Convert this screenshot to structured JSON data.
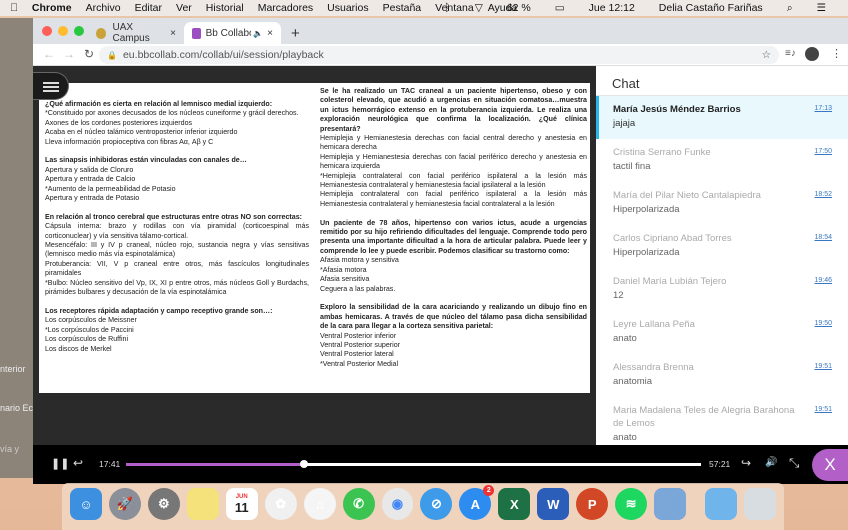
{
  "menubar": {
    "apple": "",
    "app": "Chrome",
    "items": [
      "Archivo",
      "Editar",
      "Ver",
      "Historial",
      "Marcadores",
      "Usuarios",
      "Pestaña",
      "Ventana",
      "Ayuda"
    ],
    "battery": "62 %",
    "clock": "Jue 12:12",
    "user": "Delia Castaño Fariñas"
  },
  "background_window": {
    "fragments": [
      "nterior",
      "nario Ec",
      "vía y"
    ]
  },
  "browser": {
    "tabs": [
      {
        "title": "UAX Campus"
      },
      {
        "title": "Bb Collaborate: TUTORIAS"
      }
    ],
    "url": "eu.bbcollab.com/collab/ui/session/playback"
  },
  "slide": {
    "left": [
      {
        "q": "¿Qué afirmación es cierta en relación al lemnisco medial izquierdo:",
        "a": [
          "*Constituido por axones decusados de los núcleos cuneiforme y grácil derechos.",
          "Axones de los cordones posteriores izquierdos",
          "Acaba en el núcleo talámico ventroposterior inferior izquierdo",
          "Lleva información propioceptiva con fibras Aα, Aβ y C"
        ]
      },
      {
        "q": "Las sinapsis inhibidoras están vinculadas con canales de…",
        "a": [
          "Apertura y salida de Cloruro",
          "Apertura y entrada de Calcio",
          "*Aumento de la permeabilidad de Potasio",
          "Apertura y entrada de Potasio"
        ]
      },
      {
        "q": "En relación al tronco cerebral que estructuras entre otras NO son correctas:",
        "a": [
          "Cápsula interna: brazo y rodillas con vía piramidal (corticoespinal más corticonuclear) y vía sensitiva tálamo-cortical.",
          "Mesencéfalo: III y IV p craneal, núcleo rojo, sustancia negra y vías sensitivas (lemnisco medio más vía espinotalámica)",
          "Protuberancia: VII, V p craneal entre otros, más fascículos longitudinales piramidales",
          "*Bulbo: Núcleo sensitivo del Vp, IX, XI p entre otros, más núcleos Goll y Burdachs, pirámides bulbares y decusación de la vía espinotalámica"
        ]
      },
      {
        "q": "Los receptores rápida adaptación y campo receptivo grande son…:",
        "a": [
          "Los corpúsculos de Meissner",
          "*Los corpúsculos de Paccini",
          "Los corpúsculos de Ruffini",
          "Los discos de Merkel"
        ]
      }
    ],
    "right": [
      {
        "q": "Se le ha realizado un TAC craneal a un paciente hipertenso, obeso y con colesterol elevado, que acudió a urgencias en situación comatosa…muestra un ictus hemorrágico extenso en la protuberancia izquierda. Le realiza una exploración neurológica que confirma la localización. ¿Qué clínica presentará?",
        "a": [
          "Hemiplejia y Hemianestesia derechas con facial central derecho y anestesia en hemicara derecha",
          "Hemiplejia y Hemianestesia derechas con facial periférico derecho y anestesia en hemicara izquierda",
          "*Hemiplejia contralateral con facial periférico ispilateral a la lesión más Hemianestesia contralateral y hemianestesia facial ipsilateral a la lesión",
          "Hemiplejia contralateral con facial periférico ispilateral a la lesión más Hemianestesia contralateral y hemianestesia facial contralateral a la lesión"
        ]
      },
      {
        "q": "Un paciente de 78 años, hipertenso con varios ictus, acude a urgencias remitido por su hijo refiriendo dificultades del lenguaje. Comprende todo pero presenta una importante dificultad a la hora de articular palabra. Puede leer y comprende lo lee y puede escribir. Podemos clasificar su trastorno como:",
        "a": [
          "Afasia motora y sensitiva",
          "*Afasia motora",
          "Afasia sensitiva",
          "Ceguera a las palabras."
        ]
      },
      {
        "q": "Exploro la sensibilidad de la cara acariciando y realizando un dibujo fino en ambas hemicaras. A través de que núcleo del tálamo pasa dicha sensibilidad de la cara para llegar a la corteza sensitiva parietal:",
        "a": [
          "Ventral Posterior inferior",
          "Ventral Posterior superior",
          "Ventral Posterior lateral",
          "*Ventral Posterior Medial"
        ]
      }
    ]
  },
  "chat": {
    "title": "Chat",
    "messages": [
      {
        "name": "María Jesús Méndez Barrios",
        "time": "17:13",
        "text": "jajaja",
        "selected": true
      },
      {
        "name": "Cristina Serrano Funke",
        "time": "17:50",
        "text": "tactil fina"
      },
      {
        "name": "María del Pilar Nieto Cantalapiedra",
        "time": "18:52",
        "text": "Hiperpolarizada"
      },
      {
        "name": "Carlos Cipriano Abad Torres",
        "time": "18:54",
        "text": "Hiperpolarizada"
      },
      {
        "name": "Daniel María Lubián Tejero",
        "time": "19:46",
        "text": "12"
      },
      {
        "name": "Leyre Lallana Peña",
        "time": "19:50",
        "text": "anato"
      },
      {
        "name": "Alessandra Brenna",
        "time": "19:51",
        "text": "anatomia"
      },
      {
        "name": "Maria Madalena Teles de Alegria Barahona de Lemos",
        "time": "19:51",
        "text": "anato"
      }
    ]
  },
  "player": {
    "current": "17:41",
    "total": "57:21",
    "progress_percent": 30.9,
    "close": "X"
  },
  "dock": {
    "calendar_month": "JUN",
    "calendar_day": "11",
    "appstore_badge": "2",
    "apps": [
      "finder",
      "launchpad",
      "system-preferences",
      "notes",
      "calendar",
      "photos",
      "itunes",
      "whatsapp",
      "chrome",
      "safari",
      "app-store",
      "excel",
      "word",
      "powerpoint",
      "spotify",
      "preview",
      "downloads",
      "trash"
    ]
  },
  "colors": {
    "accent": "#b260c8",
    "chat_selected": "#2bb8e6"
  }
}
